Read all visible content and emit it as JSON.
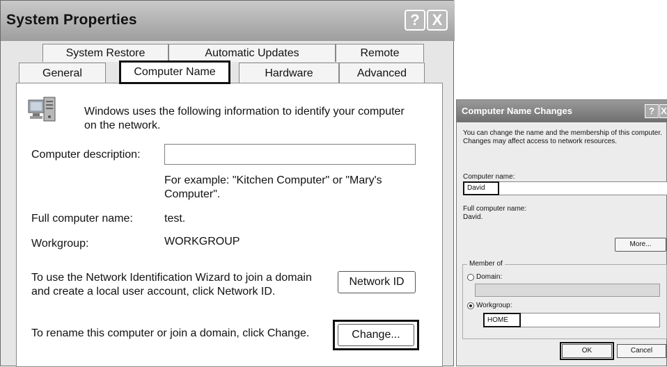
{
  "system_properties": {
    "title": "System Properties",
    "title_buttons": {
      "help": "?",
      "close": "X"
    },
    "tabs_row1": [
      "System Restore",
      "Automatic Updates",
      "Remote"
    ],
    "tabs_row2": [
      "General",
      "Computer Name",
      "Hardware",
      "Advanced"
    ],
    "active_tab": "Computer Name",
    "intro_text": "Windows uses the following information to identify your computer on the network.",
    "computer_description_label": "Computer description:",
    "computer_description_value": "",
    "example_text": "For example: \"Kitchen Computer\" or \"Mary's Computer\".",
    "full_name_label": "Full computer name:",
    "full_name_value": "test.",
    "workgroup_label": "Workgroup:",
    "workgroup_value": "WORKGROUP",
    "network_id_text": "To use the Network Identification Wizard to join a domain and create a local user account, click Network ID.",
    "network_id_button": "Network ID",
    "rename_text": "To rename this computer or join a domain, click Change.",
    "change_button": "Change..."
  },
  "computer_name_changes": {
    "title": "Computer Name Changes",
    "title_buttons": {
      "help": "?",
      "close": "X"
    },
    "intro_text": "You can change the name and the membership of this computer. Changes may affect access to network resources.",
    "computer_name_label": "Computer name:",
    "computer_name_value": "David",
    "full_name_label": "Full computer name:",
    "full_name_value": "David.",
    "more_button": "More...",
    "member_of_label": "Member of",
    "domain_label": "Domain:",
    "domain_value": "",
    "workgroup_label": "Workgroup:",
    "workgroup_value": "HOME",
    "selected_membership": "Workgroup",
    "ok_button": "OK",
    "cancel_button": "Cancel"
  },
  "icons": {
    "computer": "computer-network-icon",
    "help": "help-icon",
    "close": "close-icon"
  }
}
